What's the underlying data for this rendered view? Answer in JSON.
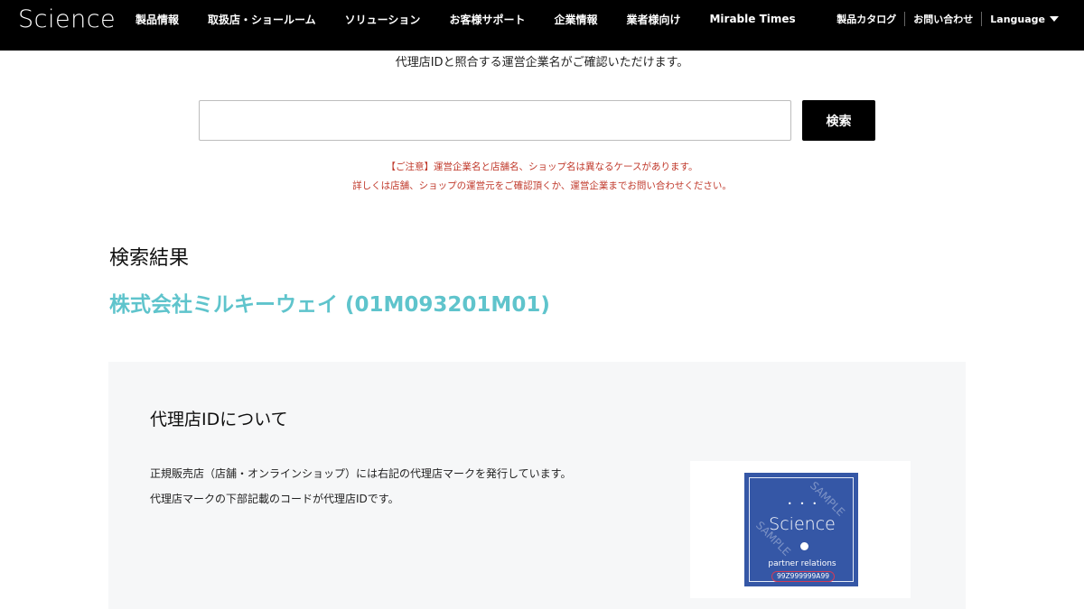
{
  "header": {
    "logo": "Science",
    "nav": [
      "製品情報",
      "取扱店・ショールーム",
      "ソリューション",
      "お客様サポート",
      "企業情報",
      "業者様向け",
      "Mirable Times"
    ],
    "utility": {
      "catalog": "製品カタログ",
      "contact": "お問い合わせ",
      "language": "Language"
    }
  },
  "search": {
    "lead": "代理店IDと照合する運営企業名がご確認いただけます。",
    "value": "",
    "placeholder": "",
    "button": "検索",
    "notice_line1": "【ご注意】運営企業名と店舗名、ショップ名は異なるケースがあります。",
    "notice_line2": "詳しくは店舗、ショップの運営元をご確認頂くか、運営企業までお問い合わせください。"
  },
  "results": {
    "heading": "検索結果",
    "items": [
      {
        "label": "株式会社ミルキーウェイ (01M093201M01)"
      }
    ]
  },
  "info": {
    "title": "代理店IDについて",
    "line1": "正規販売店（店舗・オンラインショップ）には右記の代理店マークを発行しています。",
    "line2": "代理店マークの下部記載のコードが代理店IDです。",
    "mark": {
      "dots": "•••",
      "brand": "Science",
      "subtitle": "partner relations",
      "code": "99Z999999A99",
      "watermark": "SAMPLE",
      "color": "#3557a6"
    }
  },
  "colors": {
    "header_bg": "#000000",
    "link": "#5fc4cc",
    "notice": "#c0392b",
    "panel_bg": "#f6f7f8"
  }
}
